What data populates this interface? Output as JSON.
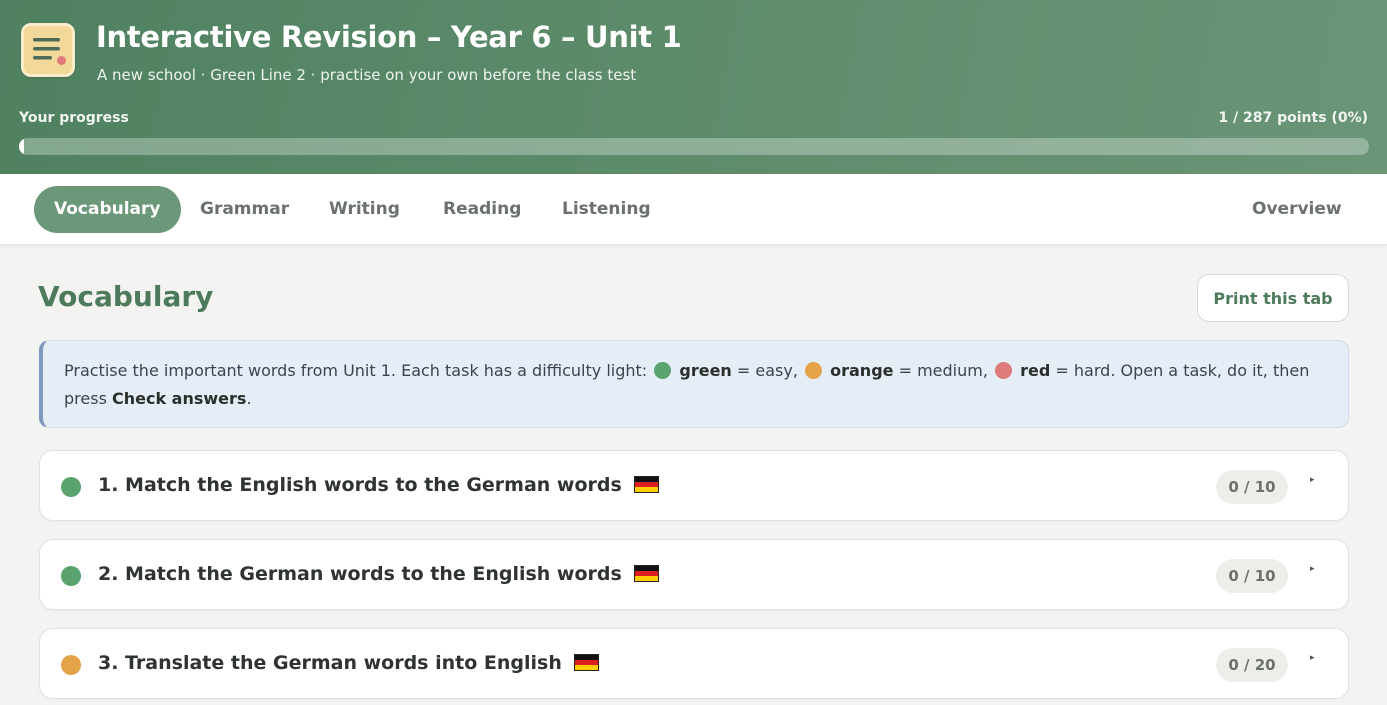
{
  "header": {
    "title": "Interactive Revision – Year 6 – Unit 1",
    "subtitle": "A new school · Green Line 2 · practise on your own before the class test",
    "progress_label": "Your progress",
    "progress_value": "1 / 287 points (0%)",
    "progress_fraction": 0.0035,
    "icon": "menu-notes-icon"
  },
  "tabs": [
    {
      "label": "Vocabulary",
      "active": true
    },
    {
      "label": "Grammar"
    },
    {
      "label": "Writing"
    },
    {
      "label": "Reading"
    },
    {
      "label": "Listening"
    },
    {
      "label": "Overview"
    }
  ],
  "section": {
    "title": "Vocabulary",
    "print_label": "Print this tab"
  },
  "info": {
    "intro": "Practise the important words from Unit 1. Each task has a difficulty light:",
    "green_word": "green",
    "green_text": "= easy,",
    "orange_word": "orange",
    "orange_text": "= medium,",
    "red_word": "red",
    "red_text": "= hard. Open a task, do it, then press",
    "check_word": "Check answers",
    "end": "."
  },
  "colors": {
    "easy": "#5aa36f",
    "medium": "#e4a349",
    "hard": "#dd7a7a",
    "accent": "#6b9878"
  },
  "tasks": [
    {
      "title": "1. Match the English words to the German words",
      "score": "0 / 10",
      "difficulty": "easy"
    },
    {
      "title": "2. Match the German words to the English words",
      "score": "0 / 10",
      "difficulty": "easy"
    },
    {
      "title": "3. Translate the German words into English",
      "score": "0 / 20",
      "difficulty": "medium"
    }
  ]
}
